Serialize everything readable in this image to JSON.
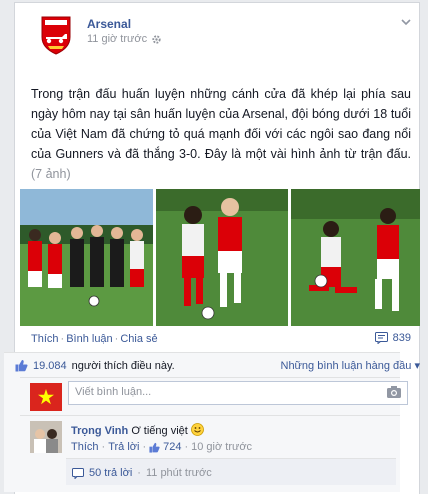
{
  "post": {
    "page_name": "Arsenal",
    "timestamp": "11 giờ trước",
    "body": "Trong trận đấu huấn luyện những cánh cửa đã khép lại phía sau ngày hôm nay tại sân huấn luyện của Arsenal, đội bóng dưới 18 tuổi của Việt Nam đã chứng tỏ quá mạnh đối với các ngôi sao đang nổi của Gunners và đã thắng 3-0. Đây là một vài hình ảnh từ trận đấu.",
    "photo_count": "(7 ảnh)"
  },
  "actions": {
    "like": "Thích",
    "comment": "Bình luận",
    "share": "Chia sẻ",
    "comment_count": "839"
  },
  "ufi": {
    "likes_count": "19.084",
    "likes_text": "người thích điều này.",
    "sort_label": "Những bình luận hàng đầu ▾",
    "comment_placeholder": "Viết bình luận..."
  },
  "top_comment": {
    "author": "Trọng Vinh",
    "text": "Ơ tiếng việt",
    "like": "Thích",
    "reply": "Trả lời",
    "like_count": "724",
    "time": "10 giờ trước"
  },
  "replies": {
    "label": "50 trả lời",
    "time": "11 phút trước"
  },
  "colors": {
    "link": "#3b5998",
    "arsenal_red": "#db0007",
    "pitch_green": "#4f8a3a"
  }
}
